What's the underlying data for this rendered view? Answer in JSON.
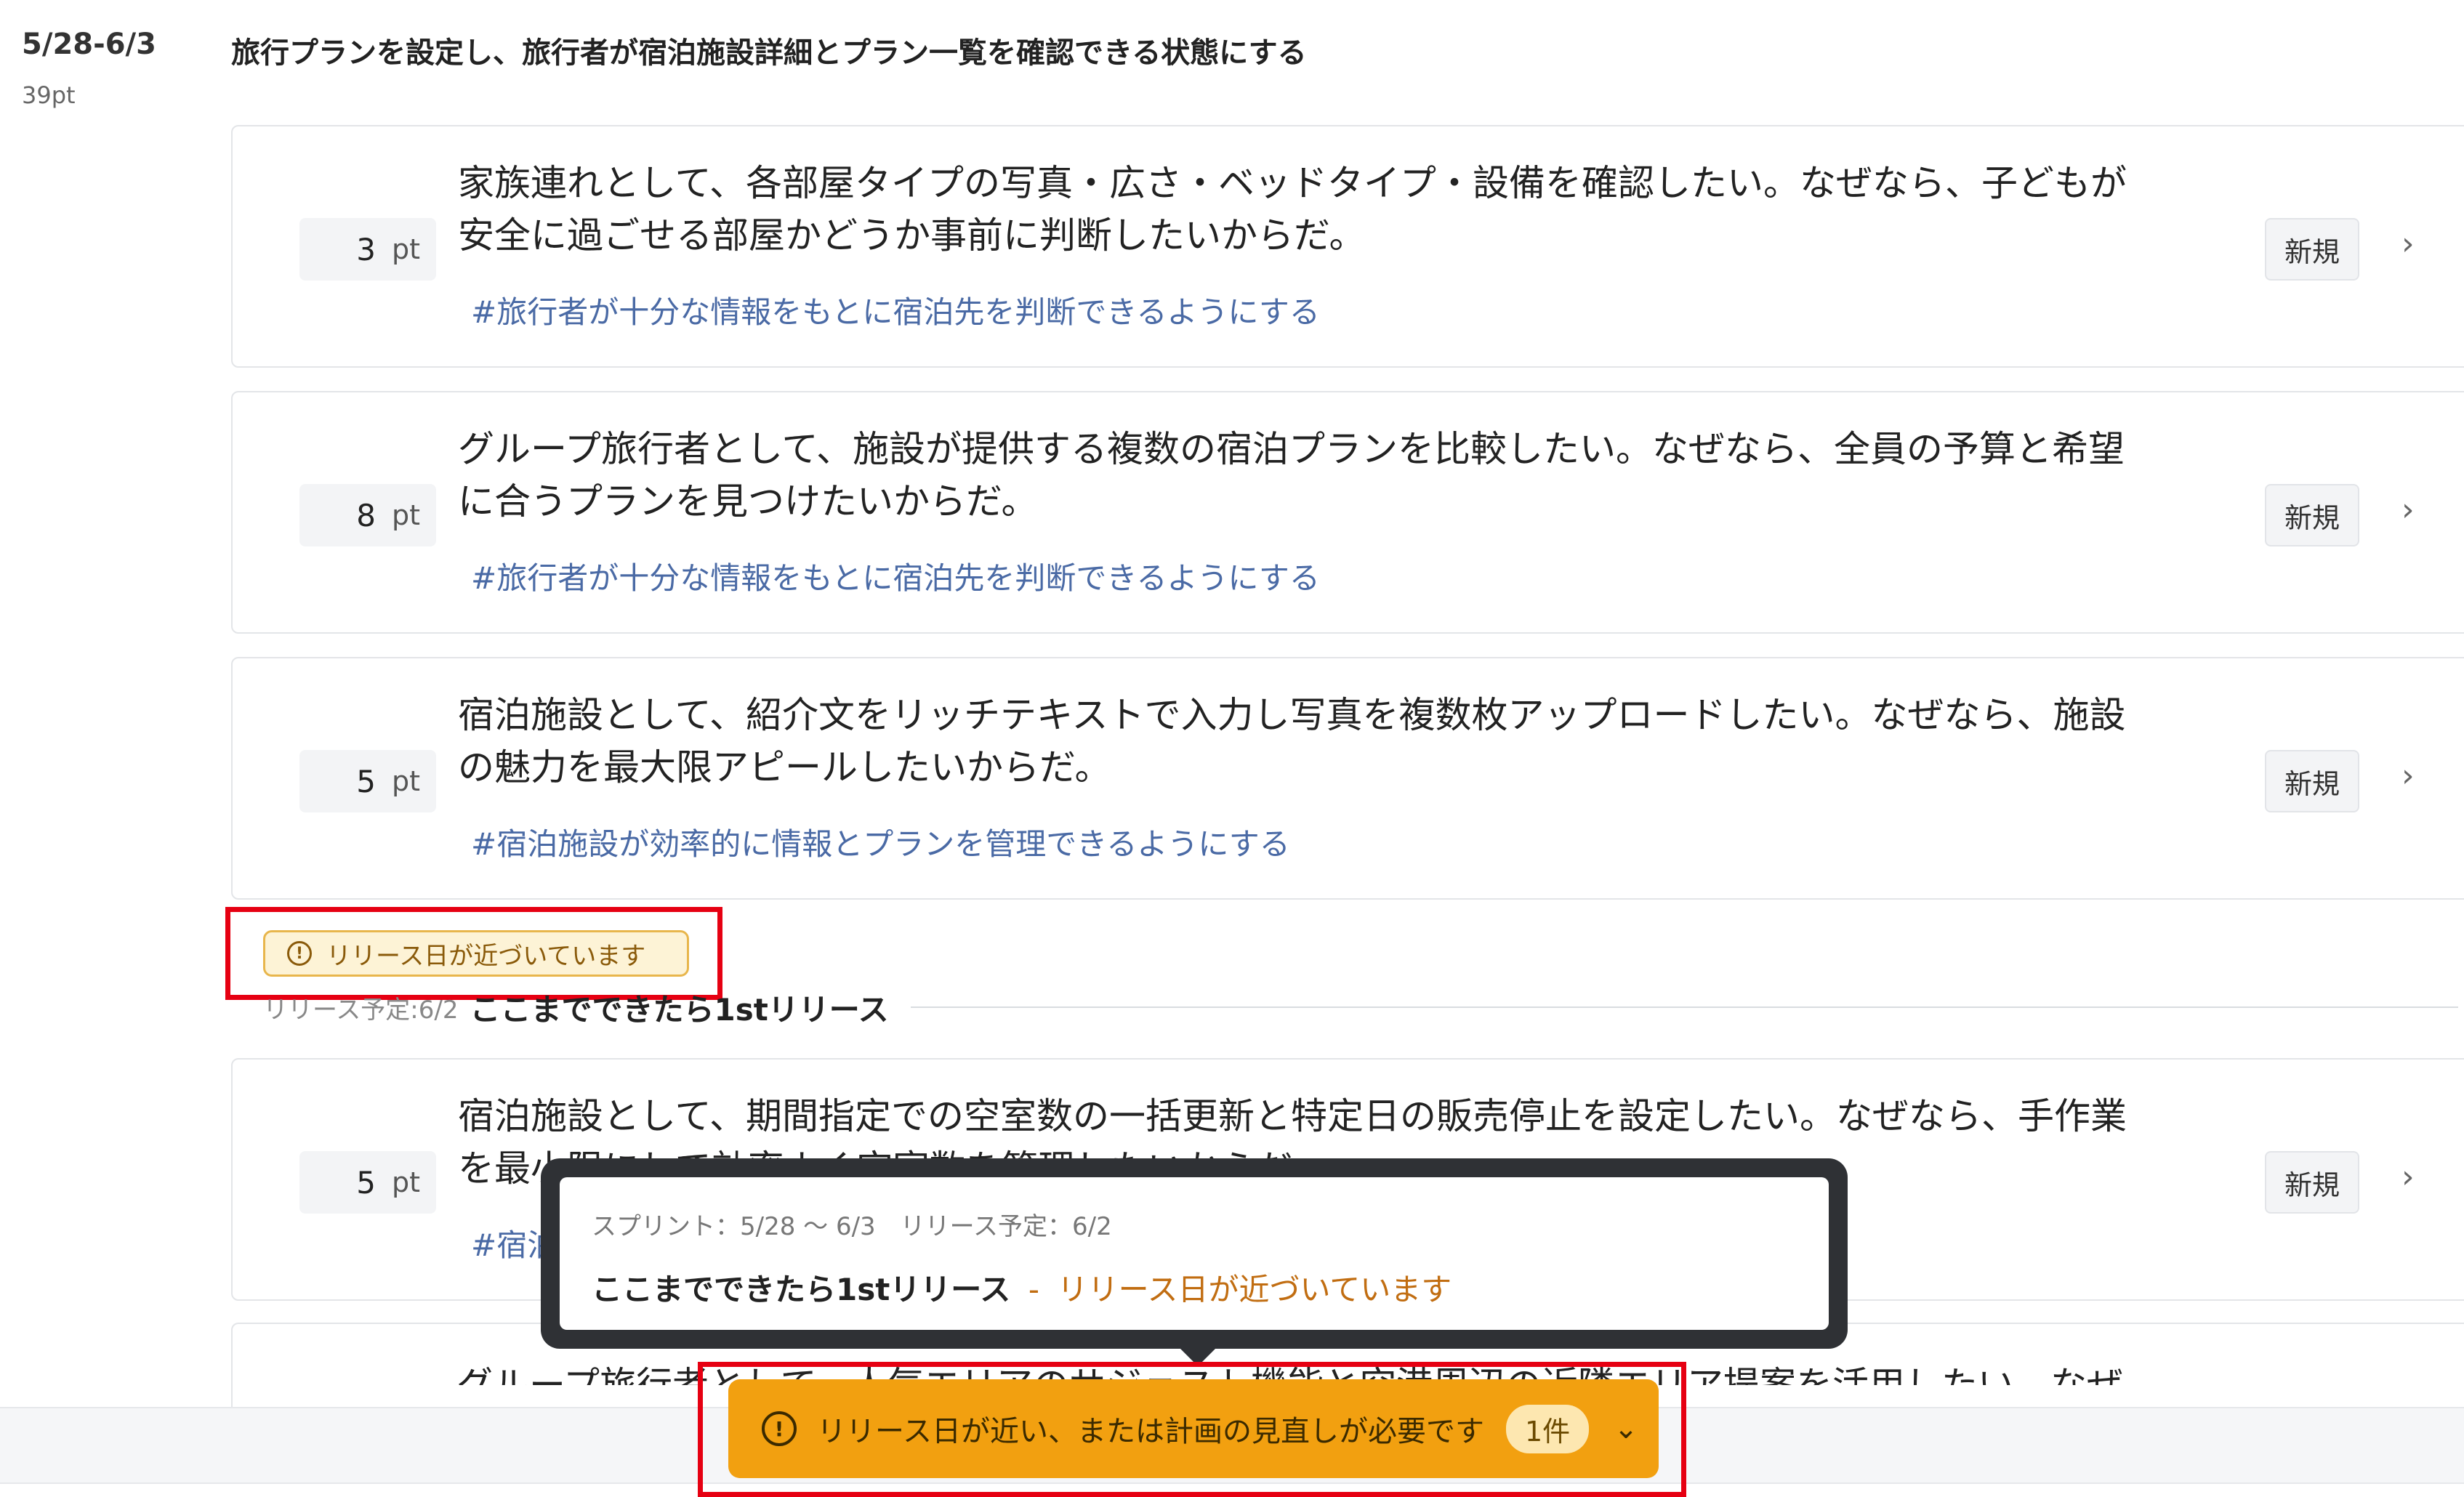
{
  "sprint": {
    "date_range": "5/28-6/3",
    "points": "39pt",
    "goal": "旅行プランを設定し、旅行者が宿泊施設詳細とプラン一覧を確認できる状態にする"
  },
  "stories": [
    {
      "points": "3",
      "unit": "pt",
      "line1": "家族連れとして、各部屋タイプの写真・広さ・ベッドタイプ・設備を確認したい。なぜなら、子どもが",
      "line2": "安全に過ごせる部屋かどうか事前に判断したいからだ。",
      "tag": "#旅行者が十分な情報をもとに宿泊先を判断できるようにする",
      "status": "新規"
    },
    {
      "points": "8",
      "unit": "pt",
      "line1": "グループ旅行者として、施設が提供する複数の宿泊プランを比較したい。なぜなら、全員の予算と希望",
      "line2": "に合うプランを見つけたいからだ。",
      "tag": "#旅行者が十分な情報をもとに宿泊先を判断できるようにする",
      "status": "新規"
    },
    {
      "points": "5",
      "unit": "pt",
      "line1": "宿泊施設として、紹介文をリッチテキストで入力し写真を複数枚アップロードしたい。なぜなら、施設",
      "line2": "の魅力を最大限アピールしたいからだ。",
      "tag": "#宿泊施設が効率的に情報とプランを管理できるようにする",
      "status": "新規"
    },
    {
      "points": "5",
      "unit": "pt",
      "line1": "宿泊施設として、期間指定での空室数の一括更新と特定日の販売停止を設定したい。なぜなら、手作業",
      "line2": "を最小限にして効率よく空室数を管理したいからだ。",
      "tag": "#宿泊施",
      "status": "新規"
    }
  ],
  "next_story_partial": "グループ旅行者として、人気エリアのサジェスト機能と空港周辺の近隣エリア提案を活用したい。なぜな",
  "release_warning": "リリース日が近づいています",
  "release_marker": {
    "date": "リリース予定:6/2",
    "title": "ここまでできたら1stリリース"
  },
  "tooltip": {
    "sub": "スプリント：5/28 〜 6/3　リリース予定：6/2",
    "title": "ここまでできたら1stリリース",
    "sep": "-",
    "warning": "リリース日が近づいています"
  },
  "alert": {
    "label": "リリース日が近い、または計画の見直しが必要です",
    "count": "1件"
  },
  "icons": {
    "alert": "exclamation-circle-icon",
    "chevron_right": "chevron-right-icon",
    "chevron_down": "chevron-down-icon"
  }
}
